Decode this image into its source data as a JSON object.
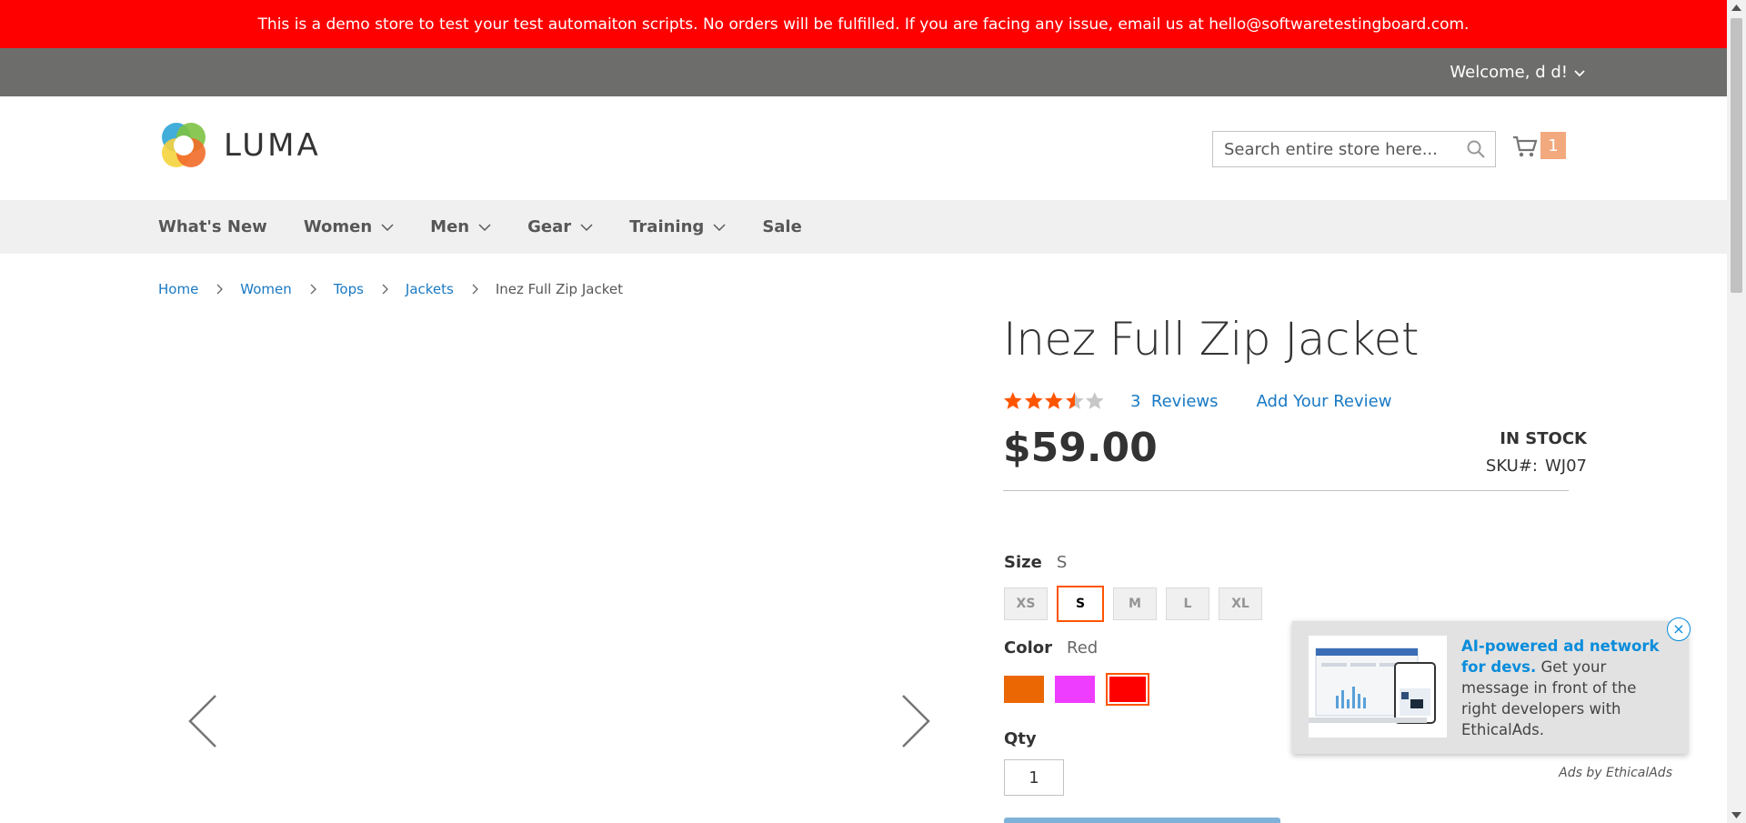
{
  "banner": {
    "text": "This is a demo store to test your test automaiton scripts. No orders will be fulfilled. If you are facing any issue, email us at hello@softwaretestingboard.com."
  },
  "header": {
    "welcome": "Welcome, d d!",
    "logo_text": "LUMA",
    "search_placeholder": "Search entire store here...",
    "cart_count": "1"
  },
  "nav": {
    "items": [
      {
        "label": "What's New",
        "has_submenu": false
      },
      {
        "label": "Women",
        "has_submenu": true
      },
      {
        "label": "Men",
        "has_submenu": true
      },
      {
        "label": "Gear",
        "has_submenu": true
      },
      {
        "label": "Training",
        "has_submenu": true
      },
      {
        "label": "Sale",
        "has_submenu": false
      }
    ]
  },
  "breadcrumbs": {
    "items": [
      "Home",
      "Women",
      "Tops",
      "Jackets"
    ],
    "current": "Inez Full Zip Jacket"
  },
  "product": {
    "title": "Inez Full Zip Jacket",
    "rating_fraction": 0.7,
    "reviews_count": "3",
    "reviews_word": "Reviews",
    "add_review": "Add Your Review",
    "price": "$59.00",
    "stock": "In stock",
    "sku_label": "SKU#:",
    "sku": "WJ07",
    "size": {
      "label": "Size",
      "selected": "S",
      "options": [
        "XS",
        "S",
        "M",
        "L",
        "XL"
      ]
    },
    "color": {
      "label": "Color",
      "selected": "Red",
      "options": [
        {
          "name": "Orange",
          "hex": "#eb6703"
        },
        {
          "name": "Purple",
          "hex": "#ef3dff"
        },
        {
          "name": "Red",
          "hex": "#ff0000"
        }
      ]
    },
    "qty": {
      "label": "Qty",
      "value": "1"
    }
  },
  "ad": {
    "headline": "AI-powered ad network for devs.",
    "body": "Get your message in front of the right developers with EthicalAds.",
    "attribution": "Ads by EthicalAds",
    "close": "×"
  },
  "colors": {
    "banner": "#ff0000",
    "panel": "#6d6e6c",
    "link": "#1979c3",
    "accent": "#ff5501",
    "star_filled": "#ff5501",
    "star_empty": "#c7c7c7"
  }
}
